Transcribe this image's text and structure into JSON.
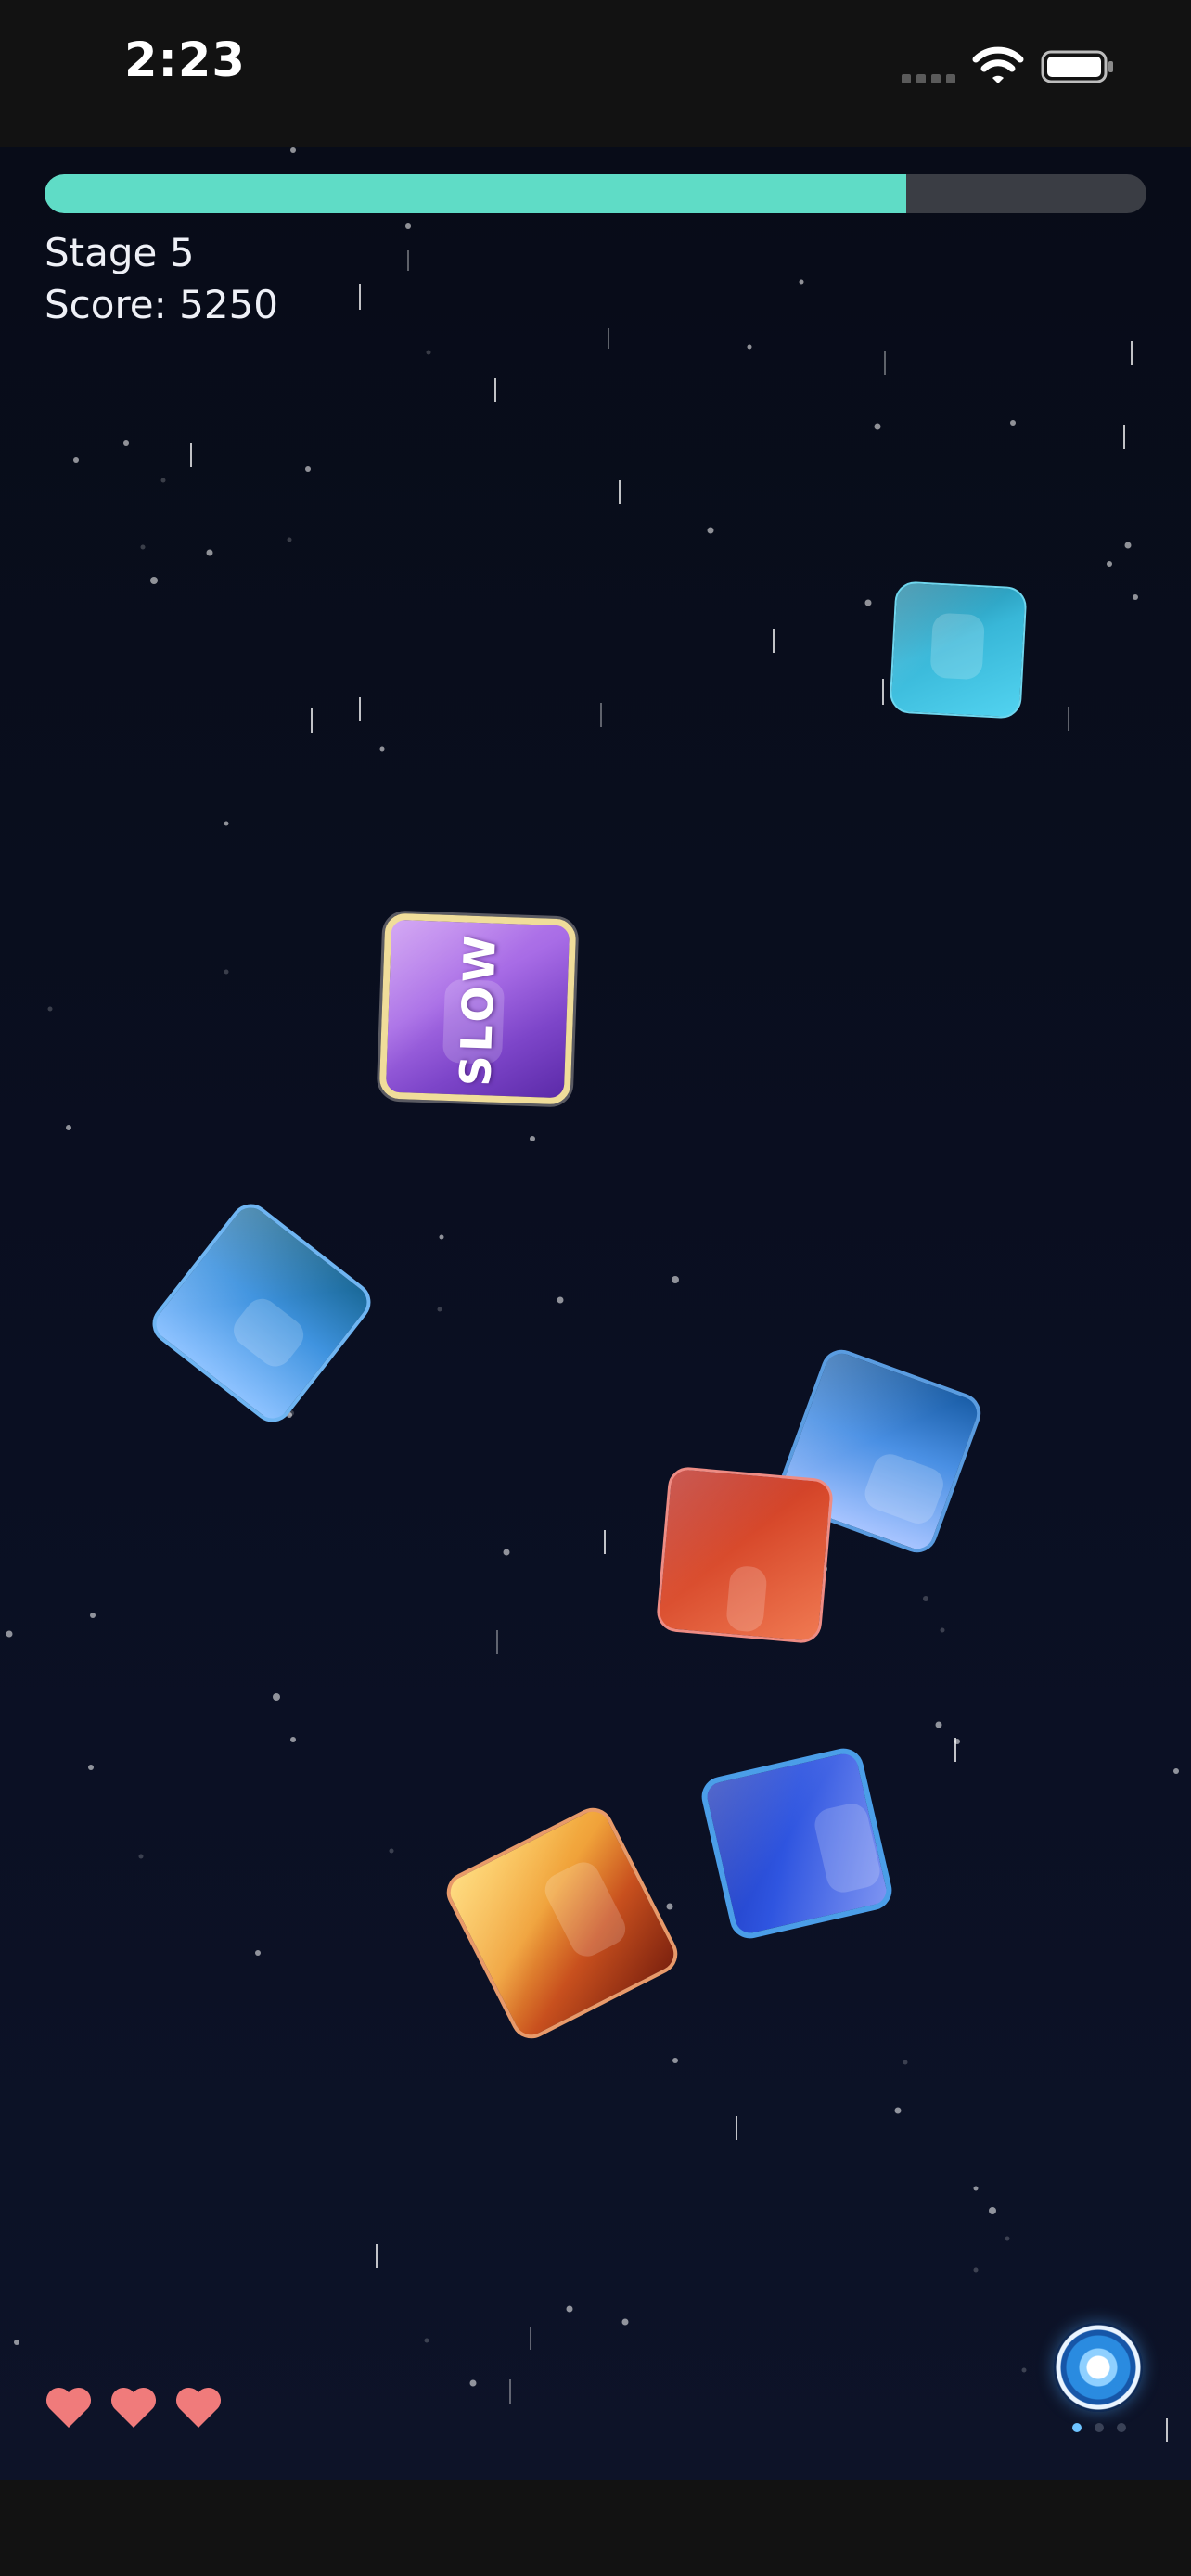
{
  "status_bar": {
    "time": "2:23",
    "icons": [
      "cellular-signal-icon",
      "wifi-icon",
      "battery-icon"
    ]
  },
  "hud": {
    "progress_fraction": 0.782,
    "progress_color": "#5fdcc6",
    "stage_text": "Stage 5",
    "score_text": "Score: 5250"
  },
  "blocks": [
    {
      "name": "cyan-block",
      "color": "#3fbfe0"
    },
    {
      "name": "slow-powerup-block",
      "color": "#9b5de5",
      "label": "SLOW"
    },
    {
      "name": "light-blue-block",
      "color": "#4f9ae8"
    },
    {
      "name": "sky-blue-block",
      "color": "#5b9cf0"
    },
    {
      "name": "red-block",
      "color": "#d8452c"
    },
    {
      "name": "royal-blue-block",
      "color": "#2f55e0"
    },
    {
      "name": "orange-yellow-block",
      "color": "#f3a33a"
    }
  ],
  "lives": {
    "count": 3,
    "icon": "heart-icon",
    "color": "#f07b7b"
  },
  "ability": {
    "icon": "ability-orb-icon",
    "page_dots": 3,
    "active_dot": 0
  }
}
